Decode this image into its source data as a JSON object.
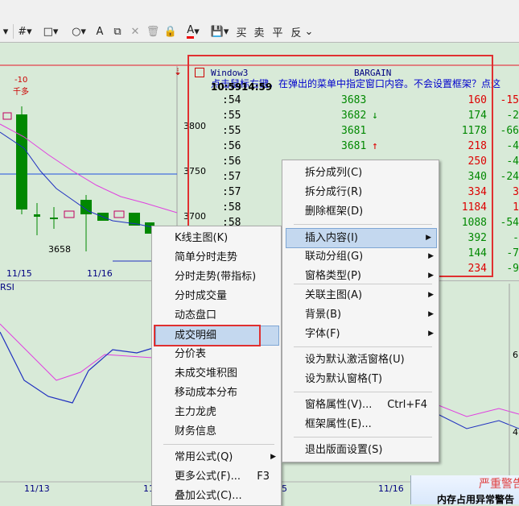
{
  "toolbar": {
    "icons": [
      "align-icon",
      "grid-icon",
      "rect-icon",
      "circle-icon",
      "text-icon",
      "copy-icon",
      "delete-icon",
      "trash-icon",
      "lock-icon",
      "color-icon",
      "save-icon"
    ],
    "text_labels": [
      "A",
      "买",
      "卖",
      "平",
      "反"
    ]
  },
  "chart": {
    "x_labels": [
      "11/15",
      "11/16"
    ],
    "y_labels": [
      "3800",
      "3750",
      "3700"
    ],
    "lower_x_labels": [
      "11/13",
      "11/"
    ],
    "lower_right_x_labels": [
      "5",
      "11/16"
    ],
    "low_label": "3658",
    "peak_label": "-10",
    "peak_sub": "千多",
    "rsi_label": "RSI",
    "rsi_right_labels": [
      "6",
      "4"
    ]
  },
  "window3": {
    "title": "Window3",
    "tab": "BARGAIN",
    "hint": "点击鼠标右键，在弹出的菜单中指定窗口内容。不会设置框架？点这",
    "trunc_time": "10:59",
    "trunc_time2": "14:59",
    "rows": [
      {
        "time": ":54",
        "price": "3683",
        "arrow": "",
        "vol": "160",
        "chg": "-15"
      },
      {
        "time": ":55",
        "price": "3682",
        "arrow": "↓",
        "vol": "174",
        "chg": "-2"
      },
      {
        "time": ":55",
        "price": "3681",
        "arrow": "",
        "vol": "1178",
        "chg": "-66"
      },
      {
        "time": ":56",
        "price": "3681",
        "arrow": "↑",
        "vol": "218",
        "chg": "-4"
      },
      {
        "time": ":56",
        "price": "",
        "arrow": "",
        "vol": "250",
        "chg": "-4"
      },
      {
        "time": ":57",
        "price": "",
        "arrow": "",
        "vol": "340",
        "chg": "-24"
      },
      {
        "time": ":57",
        "price": "",
        "arrow": "",
        "vol": "334",
        "chg": "3"
      },
      {
        "time": ":58",
        "price": "",
        "arrow": "",
        "vol": "1184",
        "chg": "1"
      },
      {
        "time": ":58",
        "price": "",
        "arrow": "",
        "vol": "1088",
        "chg": "-54"
      },
      {
        "time": "",
        "price": "",
        "arrow": "",
        "vol": "392",
        "chg": "-"
      },
      {
        "time": "",
        "price": "",
        "arrow": "",
        "vol": "144",
        "chg": "-7"
      },
      {
        "time": "",
        "price": "",
        "arrow": "",
        "vol": "234",
        "chg": "-9"
      }
    ]
  },
  "left_menu": {
    "items": [
      {
        "label": "K线主图(K)"
      },
      {
        "label": "简单分时走势"
      },
      {
        "label": "分时走势(带指标)"
      },
      {
        "label": "分时成交量"
      },
      {
        "label": "动态盘口"
      },
      {
        "label": "成交明细"
      },
      {
        "label": "分价表"
      },
      {
        "label": "未成交堆积图"
      },
      {
        "label": "移动成本分布"
      },
      {
        "label": "主力龙虎"
      },
      {
        "label": "财务信息"
      },
      {
        "label": "常用公式(Q)"
      },
      {
        "label": "更多公式(F)...",
        "shortcut": "F3"
      },
      {
        "label": "叠加公式(C)..."
      }
    ]
  },
  "right_menu": {
    "items": [
      {
        "label": "拆分成列(C)"
      },
      {
        "label": "拆分成行(R)"
      },
      {
        "label": "删除框架(D)"
      },
      {
        "label": "插入内容(I)"
      },
      {
        "label": "联动分组(G)"
      },
      {
        "label": "窗格类型(P)"
      },
      {
        "label": "关联主图(A)"
      },
      {
        "label": "背景(B)"
      },
      {
        "label": "字体(F)"
      },
      {
        "label": "设为默认激活窗格(U)"
      },
      {
        "label": "设为默认窗格(T)"
      },
      {
        "label": "窗格属性(V)...",
        "shortcut": "Ctrl+F4"
      },
      {
        "label": "框架属性(E)..."
      },
      {
        "label": "退出版面设置(S)"
      }
    ]
  },
  "toast": {
    "title": "严重警告",
    "message": "内存占用异常警告"
  },
  "colors": {
    "chart_bg": "#d8ead8",
    "up_green": "#008800",
    "down_red": "#dd0000",
    "highlight": "#c4d8ef",
    "annotation_red": "#e03030"
  }
}
